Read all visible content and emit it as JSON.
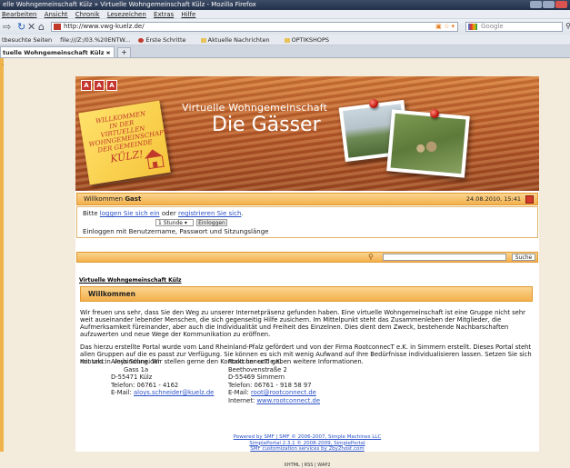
{
  "browser": {
    "window_title": "elle Wohngemeinschaft Külz » Virtuelle Wohngemeinschaft Külz - Mozilla Firefox",
    "menu": [
      "Bearbeiten",
      "Ansicht",
      "Chronik",
      "Lesezeichen",
      "Extras",
      "Hilfe"
    ],
    "url": "http://www.vwg-kuelz.de/",
    "search_placeholder": "Google",
    "bookmarks": [
      "tbesuchte Seiten",
      "file:///Z:/03.%20ENTW...",
      "Erste Schritte",
      "Aktuelle Nachrichten",
      "OPTIKSHOPS"
    ],
    "tab_title": "tuelle Wohngemeinschaft Külz » ..."
  },
  "header": {
    "font_buttons": [
      "A",
      "A",
      "A"
    ],
    "postit_lines": [
      "Willkommen",
      "in der virtuellen",
      "Wohngemeinschaft",
      "der Gemeinde"
    ],
    "postit_big": "Külz!",
    "subtitle": "Virtuelle Wohngemeinschaft",
    "title": "Die Gässer"
  },
  "welcome": {
    "prefix": "Willkommen",
    "user": "Gast",
    "date": "24.08.2010, 15:41"
  },
  "login": {
    "text_before": "Bitte",
    "login_link": "loggen Sie sich ein",
    "or": "oder",
    "register_link": "registrieren Sie sich",
    "period": ".",
    "duration_value": "1 Stunde",
    "login_button": "Einloggen",
    "note": "Einloggen mit Benutzername, Passwort und Sitzungslänge"
  },
  "search": {
    "button": "Suche"
  },
  "breadcrumb": "Virtuelle Wohngemeinschaft Külz",
  "section": {
    "title": "Willkommen",
    "para1": "Wir freuen uns sehr, dass Sie den Weg zu unserer Internetpräsenz gefunden haben. Eine virtuelle Wohngemeinschaft ist eine Gruppe nicht sehr weit auseinander lebender Menschen, die sich gegenseitig Hilfe zusichern. Im Mittelpunkt steht das Zusammenleben der Mitglieder, die Aufmerksamkeit füreinander, aber auch die Individualität und Freiheit des Einzelnen. Dies dient dem Zweck, bestehende Nachbarschaften aufzuwerten und neue Wege der Kommunikation zu eröffnen.",
    "para2": "Das hierzu erstellte Portal wurde vom Land Rheinland-Pfalz gefördert und von der Firma RootconnecT e.K. in Simmern erstellt. Dieses Portal steht allen Gruppen auf die es passt zur Verfügung. Sie können es sich mit wenig Aufwand auf Ihre Bedürfnisse individualisieren lassen. Setzen Sie sich mit uns in Verbindung. Wir stellen gerne den Kontakt her und geben weitere Informationen."
  },
  "contact": {
    "label": "Kontakt:",
    "person": {
      "name": "Aloys Schneider",
      "street": "Gass 1a",
      "city": "D-55471 Külz",
      "phone": "Telefon: 06761 - 4162",
      "email_label": "E-Mail:",
      "email": "aloys.schneider@kuelz.de"
    },
    "company": {
      "name": "RootconnecT e.K.",
      "street": "Beethovenstraße 2",
      "city": "D-55469 Simmern",
      "phone": "Telefon: 06761 - 918 58 97",
      "email_label": "E-Mail:",
      "email": "root@rootconnect.de",
      "web_label": "Internet:",
      "web": "www.rootconnect.de"
    }
  },
  "footer": {
    "line1": "Powered by SMF | SMF © 2006-2007, Simple Machines LLC",
    "line2": "SimplePortal 2.3.1 © 2008-2009, SimplePortal",
    "line3": "SMF customization services by 2by2host.com",
    "links": "XHTML | RSS | WAP2"
  },
  "colors": {
    "accent": "#f3b04c",
    "header": "#b5582a",
    "link": "#2a50c8",
    "alert": "#c4352e"
  }
}
